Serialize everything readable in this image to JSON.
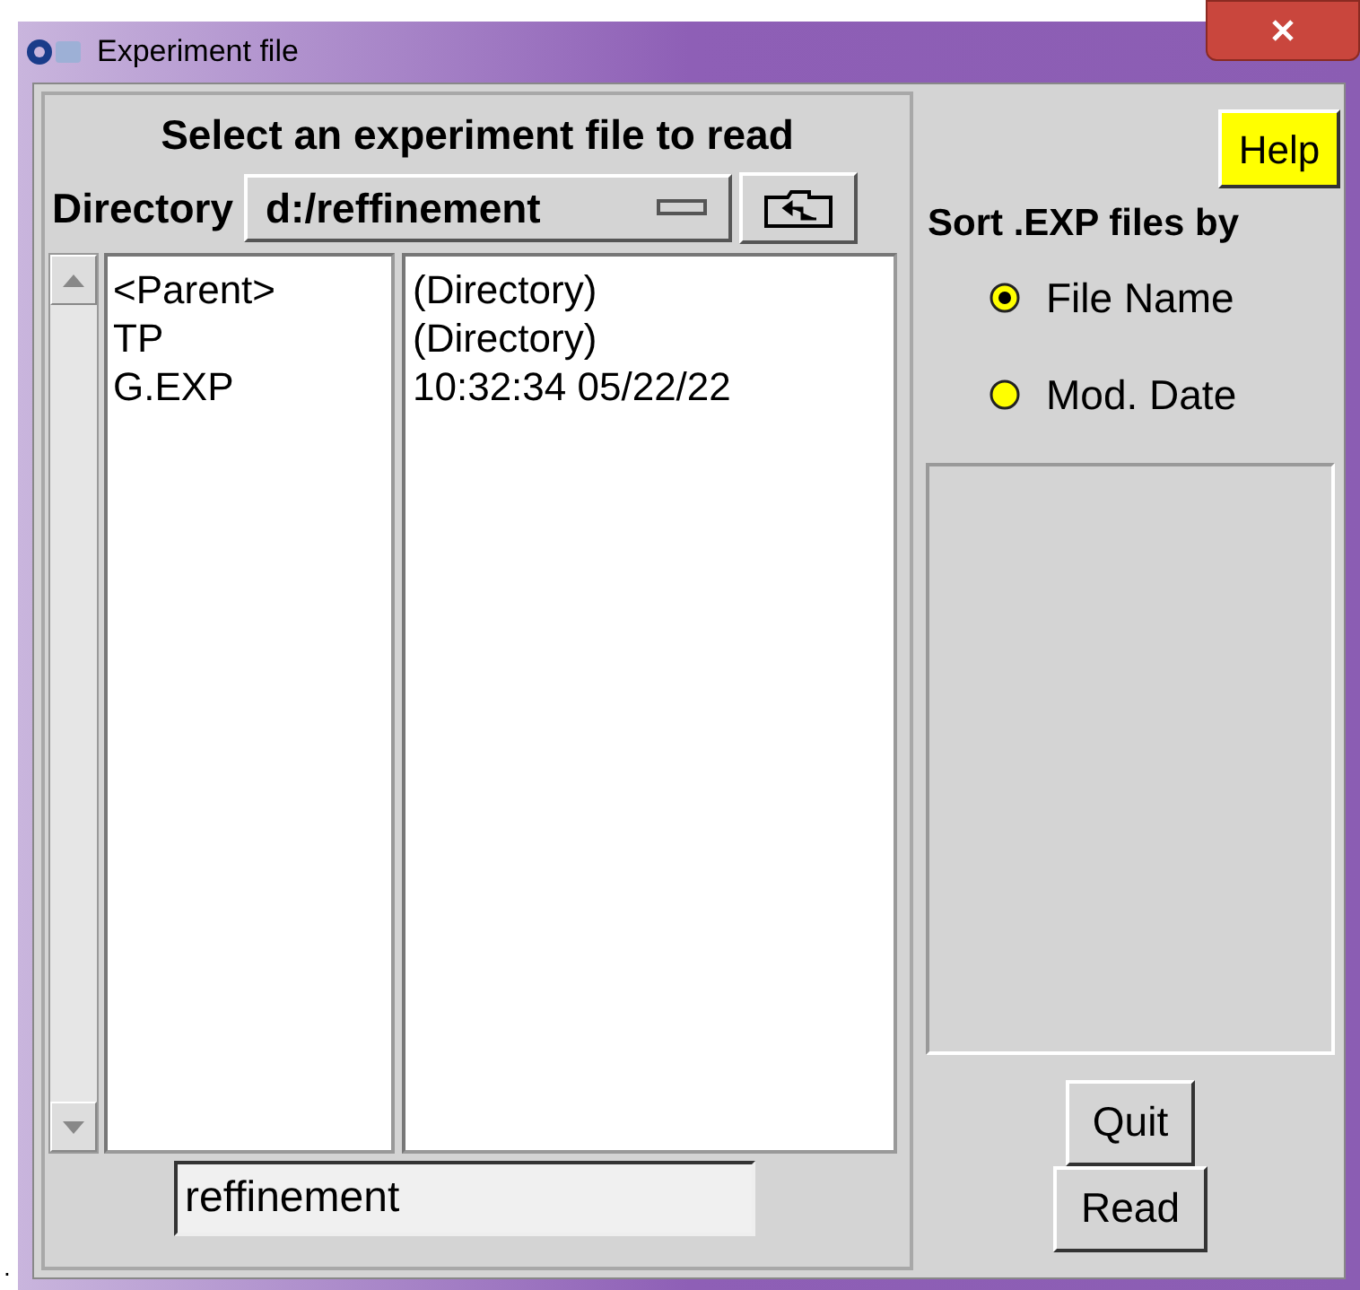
{
  "window": {
    "title": "Experiment file"
  },
  "file_panel": {
    "heading": "Select an experiment file to read",
    "directory_label": "Directory",
    "directory_value": "d:/reffinement",
    "files": [
      {
        "name": "<Parent>",
        "info": "(Directory)"
      },
      {
        "name": "TP",
        "info": "(Directory)"
      },
      {
        "name": "G.EXP",
        "info": "10:32:34 05/22/22"
      }
    ],
    "filename_value": "reffinement"
  },
  "side_panel": {
    "help_button": "Help",
    "sort_label": "Sort .EXP files by",
    "sort_options": [
      {
        "label": "File Name",
        "selected": true
      },
      {
        "label": "Mod. Date",
        "selected": false
      }
    ],
    "buttons": [
      "Quit",
      "Read"
    ]
  },
  "stray_mark": "."
}
